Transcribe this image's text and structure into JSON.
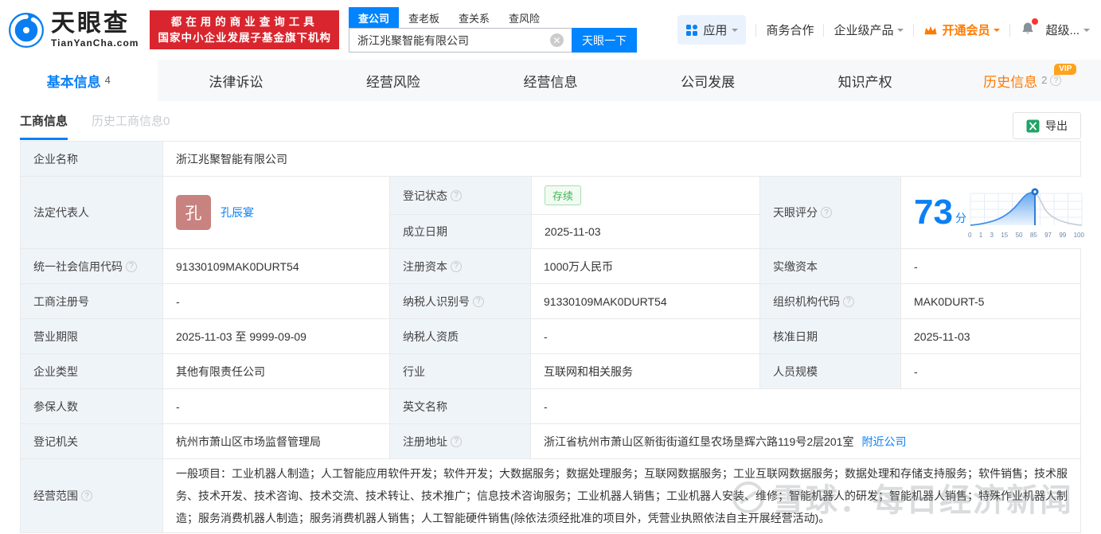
{
  "colors": {
    "accent_blue": "#0084ff",
    "brand_red": "#d9252e",
    "vip_orange": "#ff7a00",
    "status_green": "#3eb650",
    "avatar_bg": "#c8827f",
    "label_cell_bg": "#eff4f9"
  },
  "header": {
    "logo_title": "天眼查",
    "logo_domain": "TianYanCha.com",
    "banner_line1": "都在用的商业查询工具",
    "banner_line2": "国家中小企业发展子基金旗下机构",
    "search_tabs": [
      {
        "label": "查公司"
      },
      {
        "label": "查老板"
      },
      {
        "label": "查关系"
      },
      {
        "label": "查风险"
      }
    ],
    "search_value": "浙江兆聚智能有限公司",
    "search_button": "天眼一下",
    "menu_apps": "应用",
    "menu_cooperation": "商务合作",
    "menu_enterprise": "企业级产品",
    "menu_vip": "开通会员",
    "menu_super": "超级...",
    "vip_badge": "VIP"
  },
  "nav_tabs": [
    {
      "label": "基本信息",
      "count": "4"
    },
    {
      "label": "法律诉讼"
    },
    {
      "label": "经营风险"
    },
    {
      "label": "经营信息"
    },
    {
      "label": "公司发展"
    },
    {
      "label": "知识产权"
    },
    {
      "label": "历史信息",
      "count": "2"
    }
  ],
  "sub_tabs": {
    "business": "工商信息",
    "history": "历史工商信息0",
    "export": "导出"
  },
  "table": {
    "row1": {
      "label": "企业名称",
      "value": "浙江兆聚智能有限公司"
    },
    "row2": {
      "label": "法定代表人",
      "avatar_char": "孔",
      "name": "孔辰宴",
      "status_label": "登记状态",
      "status": "存续",
      "established_label": "成立日期",
      "established": "2025-11-03",
      "score_label": "天眼评分",
      "score": "73",
      "score_suffix": "分"
    },
    "row3": {
      "c1_label": "统一社会信用代码",
      "c1": "91330109MAK0DURT54",
      "c2_label": "注册资本",
      "c2": "1000万人民币",
      "c3_label": "实缴资本",
      "c3": "-"
    },
    "row4": {
      "c1_label": "工商注册号",
      "c1": "-",
      "c2_label": "纳税人识别号",
      "c2": "91330109MAK0DURT54",
      "c3_label": "组织机构代码",
      "c3": "MAK0DURT-5"
    },
    "row5": {
      "c1_label": "营业期限",
      "c1": "2025-11-03 至 9999-09-09",
      "c2_label": "纳税人资质",
      "c2": "-",
      "c3_label": "核准日期",
      "c3": "2025-11-03"
    },
    "row6": {
      "c1_label": "企业类型",
      "c1": "其他有限责任公司",
      "c2_label": "行业",
      "c2": "互联网和相关服务",
      "c3_label": "人员规模",
      "c3": "-"
    },
    "row7": {
      "c1_label": "参保人数",
      "c1": "-",
      "c2_label": "英文名称",
      "c2": "-"
    },
    "row8": {
      "c1_label": "登记机关",
      "c1": "杭州市萧山区市场监督管理局",
      "c2_label": "注册地址",
      "c2": "浙江省杭州市萧山区新街街道红垦农场垦辉六路119号2层201室",
      "c2_link": "附近公司"
    },
    "row9": {
      "label": "经营范围",
      "value": "一般项目：工业机器人制造；人工智能应用软件开发；软件开发；大数据服务；数据处理服务；互联网数据服务；工业互联网数据服务；数据处理和存储支持服务；软件销售；技术服务、技术开发、技术咨询、技术交流、技术转让、技术推广；信息技术咨询服务；工业机器人销售；工业机器人安装、维修；智能机器人的研发；智能机器人销售；特殊作业机器人制造；服务消费机器人制造；服务消费机器人销售；人工智能硬件销售(除依法须经批准的项目外，凭营业执照依法自主开展经营活动)。"
    }
  },
  "score_chart": {
    "type": "area",
    "score": 73,
    "unit": "分",
    "axis_ticks": [
      "0",
      "1",
      "3",
      "15",
      "50",
      "85",
      "97",
      "99",
      "100"
    ]
  },
  "watermark": "雪球：每日经济新闻"
}
